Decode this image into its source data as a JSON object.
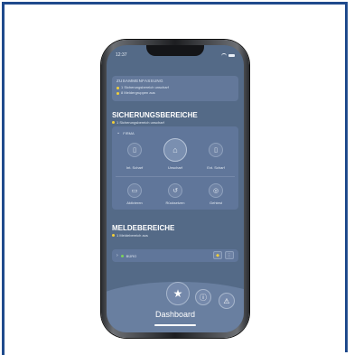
{
  "status_bar": {
    "time": "12:37"
  },
  "summary": {
    "title": "ZUSAMMENFASSUNG",
    "lines": [
      "1 Sicherungsbereich unscharf",
      "8 Meldergruppen aus"
    ]
  },
  "security": {
    "title": "SICHERUNGSBEREICHE",
    "subtitle": "1 Sicherungsbereich unscharf",
    "area_name": "FIRMA",
    "controls": [
      {
        "label": "Int. Scharf"
      },
      {
        "label": "Unscharf"
      },
      {
        "label": "Ext. Scharf"
      }
    ],
    "actions": [
      {
        "label": "Aktivieren"
      },
      {
        "label": "Rücksetzen"
      },
      {
        "label": "Gehtest"
      }
    ]
  },
  "reporting": {
    "title": "MELDEBEREICHE",
    "subtitle": "1 Meldebereich aus",
    "item_name": "BÜRO"
  },
  "nav": {
    "active_label": "Dashboard"
  },
  "colors": {
    "frame": "#1f4a8c",
    "screen_bg": "#546a87",
    "warning": "#f1cf3a",
    "ok": "#7cd35c"
  }
}
